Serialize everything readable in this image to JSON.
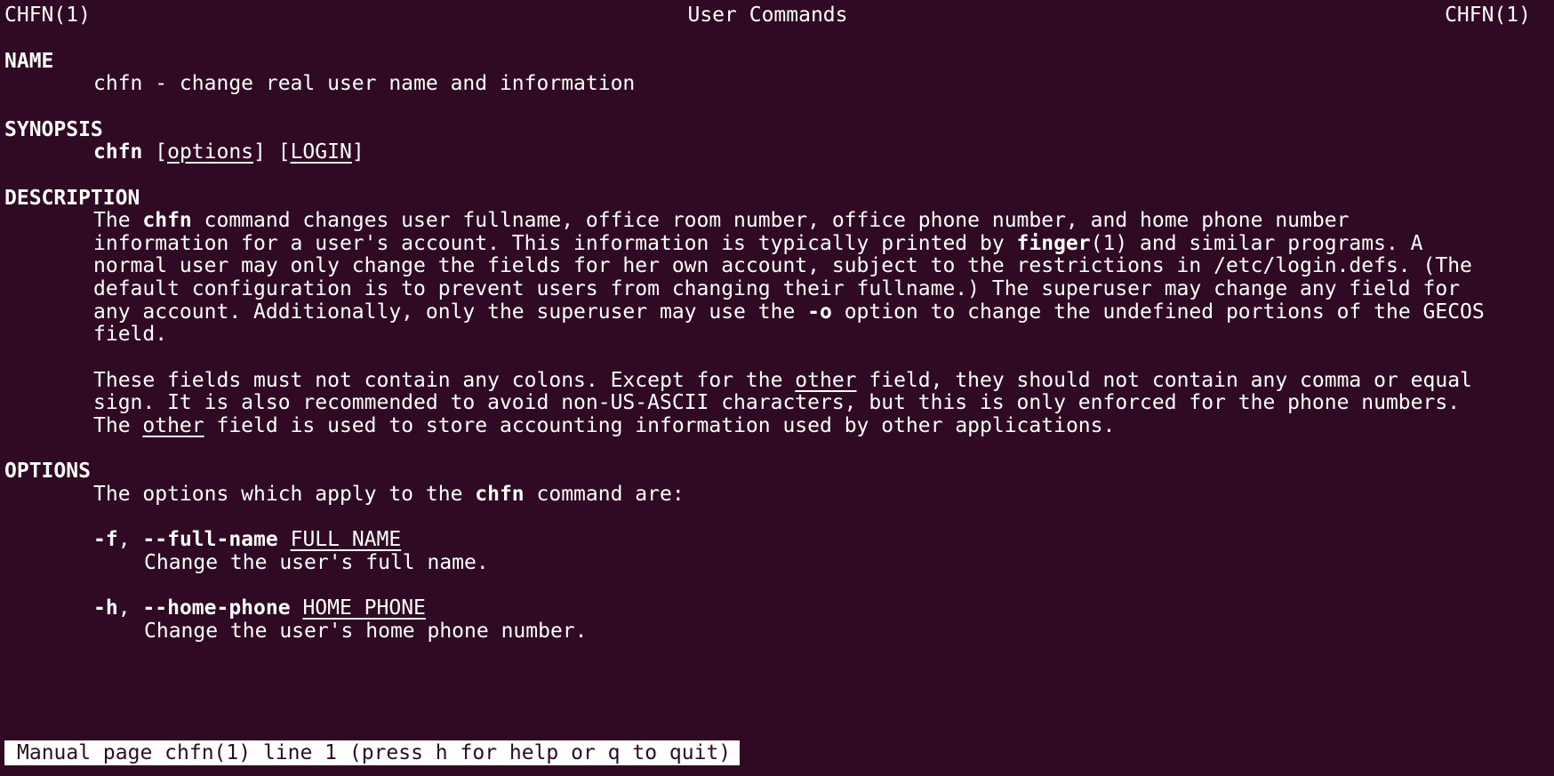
{
  "header": {
    "left": "CHFN(1)",
    "center": "User Commands",
    "right": "CHFN(1)"
  },
  "sections": {
    "name": {
      "heading": "NAME",
      "text": "chfn - change real user name and information"
    },
    "synopsis": {
      "heading": "SYNOPSIS",
      "cmd": "chfn",
      "open1": " [",
      "options": "options",
      "mid": "] [",
      "login": "LOGIN",
      "close": "]"
    },
    "description": {
      "heading": "DESCRIPTION",
      "p1": {
        "l1_a": "The ",
        "l1_cmd": "chfn",
        "l1_b": " command changes user fullname, office room number, office phone number, and home phone number",
        "l2_a": "information for a user's account. This information is typically printed by ",
        "l2_finger": "finger",
        "l2_b": "(1) and similar programs. A",
        "l3": "normal user may only change the fields for her own account, subject to the restrictions in /etc/login.defs. (The",
        "l4": "default configuration is to prevent users from changing their fullname.) The superuser may change any field for",
        "l5_a": "any account. Additionally, only the superuser may use the ",
        "l5_opt": "-o",
        "l5_b": " option to change the undefined portions of the GECOS",
        "l6": "field."
      },
      "p2": {
        "l1_a": "These fields must not contain any colons. Except for the ",
        "l1_other": "other",
        "l1_b": " field, they should not contain any comma or equal",
        "l2": "sign. It is also recommended to avoid non-US-ASCII characters, but this is only enforced for the phone numbers.",
        "l3_a": "The ",
        "l3_other": "other",
        "l3_b": " field is used to store accounting information used by other applications."
      }
    },
    "options": {
      "heading": "OPTIONS",
      "intro_a": "The options which apply to the ",
      "intro_cmd": "chfn",
      "intro_b": " command are:",
      "items": [
        {
          "short": "-f",
          "sep": ", ",
          "long": "--full-name",
          "arg": "FULL_NAME",
          "desc": "Change the user's full name."
        },
        {
          "short": "-h",
          "sep": ", ",
          "long": "--home-phone",
          "arg": "HOME_PHONE",
          "desc": "Change the user's home phone number."
        }
      ]
    }
  },
  "status": "Manual page chfn(1) line 1 (press h for help or q to quit)",
  "colors": {
    "background": "#300a24",
    "foreground": "#ffffff"
  }
}
